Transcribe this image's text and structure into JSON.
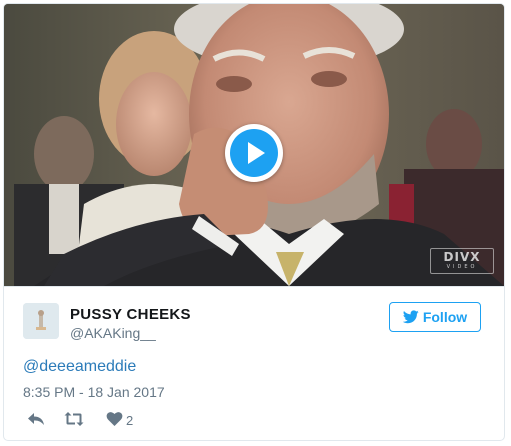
{
  "tweet": {
    "display_name": "PUSSY CHEEKS",
    "screen_name": "@AKAKing__",
    "text": "@deeeameddie",
    "timestamp": "8:35 PM - 18 Jan 2017",
    "like_count": "2"
  },
  "follow": {
    "label": "Follow"
  },
  "media": {
    "type": "video",
    "watermark": "DIVX",
    "watermark_sub": "VIDEO"
  },
  "icons": {
    "play": "play-icon",
    "bird": "twitter-bird-icon",
    "reply": "reply-icon",
    "retweet": "retweet-icon",
    "like": "heart-icon"
  },
  "colors": {
    "accent": "#1da1f2",
    "link": "#2b7bb9",
    "secondary_text": "#657786",
    "border": "#e1e8ed"
  }
}
